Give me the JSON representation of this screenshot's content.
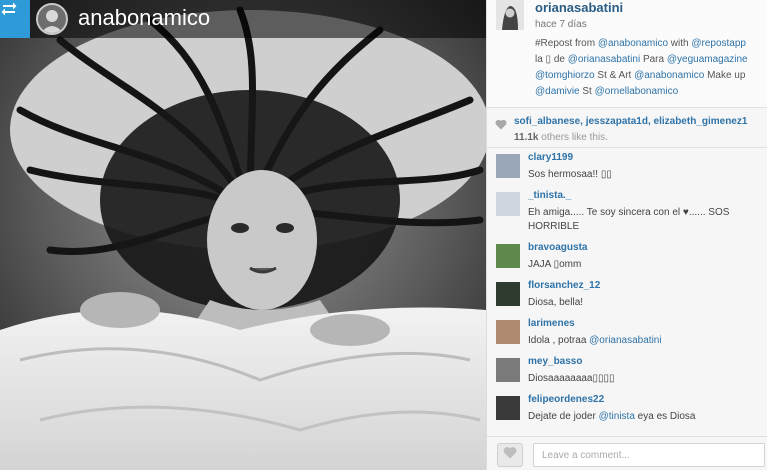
{
  "repost": {
    "username": "anabonamico"
  },
  "post": {
    "owner": "orianasabatini",
    "time": "hace 7 días",
    "caption_segments": [
      [
        {
          "t": "#Repost from ",
          "m": false
        },
        {
          "t": "@anabonamico",
          "m": true
        },
        {
          "t": " with ",
          "m": false
        },
        {
          "t": "@repostapp",
          "m": true
        }
      ],
      [
        {
          "t": "la ▯ de ",
          "m": false
        },
        {
          "t": "@orianasabatini",
          "m": true
        },
        {
          "t": " Para ",
          "m": false
        },
        {
          "t": "@yeguamagazine",
          "m": true
        },
        {
          "t": " ",
          "m": false
        }
      ],
      [
        {
          "t": "@tomghiorzo",
          "m": true
        },
        {
          "t": " St & Art ",
          "m": false
        },
        {
          "t": "@anabonamico",
          "m": true
        },
        {
          "t": " Make up",
          "m": false
        }
      ],
      [
        {
          "t": "@damivie",
          "m": true
        },
        {
          "t": " St ",
          "m": false
        },
        {
          "t": "@ornellabonamico",
          "m": true
        }
      ]
    ]
  },
  "likes": {
    "users": "sofi_albanese, jesszapata1d, elizabeth_gimenez1",
    "count": "11.1k",
    "suffix": "others like this."
  },
  "comments": [
    {
      "user": "clary1199",
      "segments": [
        {
          "t": "Sos hermosaa!! ▯▯",
          "m": false
        }
      ]
    },
    {
      "user": "_tinista._",
      "segments": [
        {
          "t": "Eh amiga..... Te soy sincera con el ♥...... SOS HORRIBLE",
          "m": false
        }
      ]
    },
    {
      "user": "bravoagusta",
      "segments": [
        {
          "t": "JAJA ▯omm",
          "m": false
        }
      ]
    },
    {
      "user": "florsanchez_12",
      "segments": [
        {
          "t": "Diosa, bella!",
          "m": false
        }
      ]
    },
    {
      "user": "larimenes",
      "segments": [
        {
          "t": "Idola , potraa ",
          "m": false
        },
        {
          "t": "@orianasabatini",
          "m": true
        }
      ]
    },
    {
      "user": "mey_basso",
      "segments": [
        {
          "t": "Diosaaaaaaaa▯▯▯▯",
          "m": false
        }
      ]
    },
    {
      "user": "felipeordenes22",
      "segments": [
        {
          "t": "Dejate de joder ",
          "m": false
        },
        {
          "t": "@tinista",
          "m": true
        },
        {
          "t": " eya es Diosa",
          "m": false
        }
      ]
    }
  ],
  "footer": {
    "comment_placeholder": "Leave a comment..."
  },
  "icons": {
    "repost": "repost-icon",
    "heart": "heart-icon"
  },
  "colors": {
    "accent_blue": "#2e9ad8",
    "link": "#2e73a8",
    "username": "#2a5d86"
  }
}
